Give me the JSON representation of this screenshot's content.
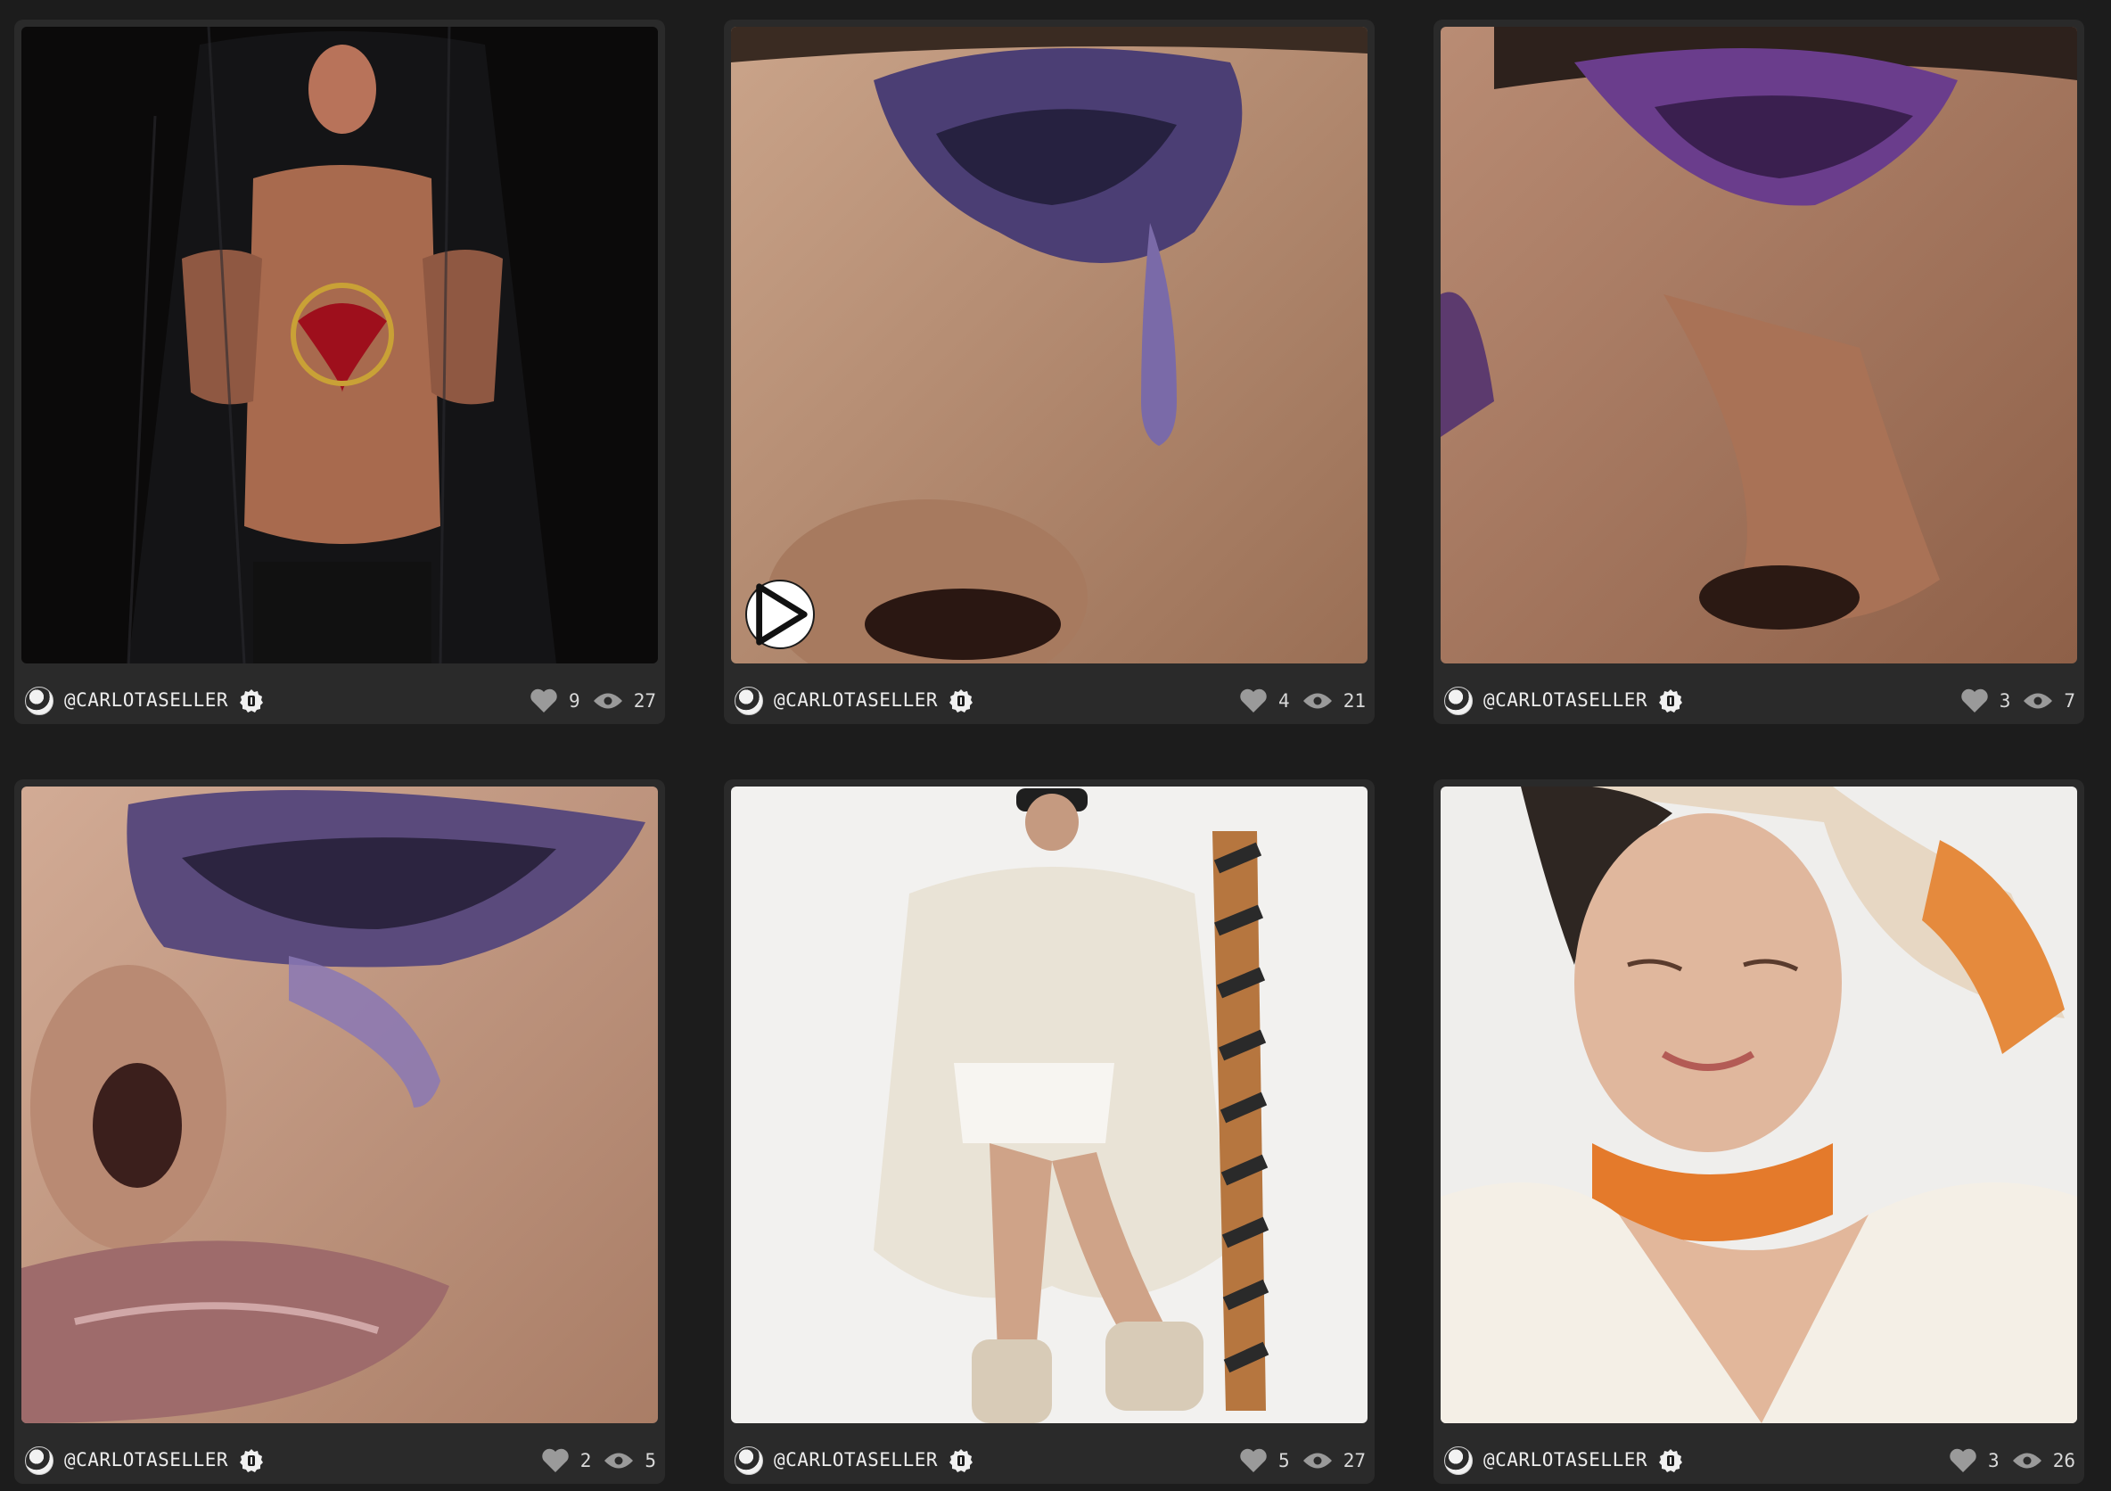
{
  "posts": [
    {
      "handle": "@CARLOTASELLER",
      "likes": "9",
      "views": "27",
      "video": false,
      "image": "veiled-model-heart"
    },
    {
      "handle": "@CARLOTASELLER",
      "likes": "4",
      "views": "21",
      "video": true,
      "image": "purple-glitter-tear-closeup"
    },
    {
      "handle": "@CARLOTASELLER",
      "likes": "3",
      "views": "7",
      "video": false,
      "image": "purple-eyeshadow-closeup"
    },
    {
      "handle": "@CARLOTASELLER",
      "likes": "2",
      "views": "5",
      "video": false,
      "image": "glitter-eye-lips-closeup"
    },
    {
      "handle": "@CARLOTASELLER",
      "likes": "5",
      "views": "27",
      "video": false,
      "image": "fur-coat-ski-model"
    },
    {
      "handle": "@CARLOTASELLER",
      "likes": "3",
      "views": "26",
      "video": false,
      "image": "orange-silk-scarf-portrait"
    }
  ],
  "colors": {
    "background": "#1c1c1c",
    "card": "#2a2a2a",
    "text": "#ededed",
    "icon": "#9a9a9a"
  },
  "icons": {
    "like": "heart-icon",
    "views": "eye-icon",
    "verified": "verified-badge-icon",
    "play": "play-icon"
  }
}
